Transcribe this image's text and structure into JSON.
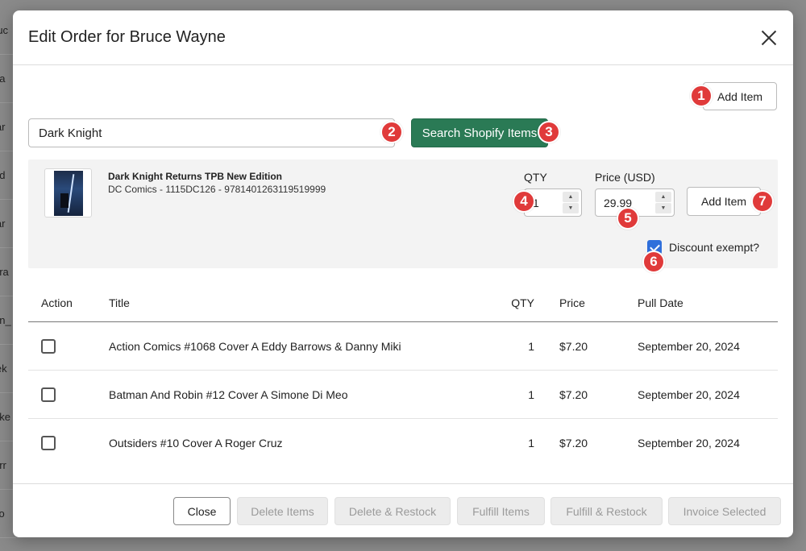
{
  "background": {
    "row_fragments": [
      "ruc",
      "ria",
      "lar",
      "ed",
      "iar",
      "ara",
      "en_",
      "iek",
      "uke",
      "arr",
      "co"
    ]
  },
  "modal": {
    "title": "Edit Order for Bruce Wayne",
    "close_icon": "close-icon",
    "add_item_top_label": "Add Item",
    "search": {
      "value": "Dark Knight",
      "button_label": "Search Shopify Items"
    },
    "result": {
      "title": "Dark Knight Returns TPB New Edition",
      "subtitle": "DC Comics - 1115DC126 - 9781401263119519999",
      "qty_label": "QTY",
      "qty_value": "1",
      "price_label": "Price (USD)",
      "price_value": "29.99",
      "add_button_label": "Add Item",
      "discount_label": "Discount exempt?",
      "discount_checked": true
    },
    "table": {
      "headers": {
        "action": "Action",
        "title": "Title",
        "qty": "QTY",
        "price": "Price",
        "pull_date": "Pull Date"
      },
      "rows": [
        {
          "title": "Action Comics #1068 Cover A Eddy Barrows & Danny Miki",
          "qty": "1",
          "price": "$7.20",
          "pull_date": "September 20, 2024"
        },
        {
          "title": "Batman And Robin #12 Cover A Simone Di Meo",
          "qty": "1",
          "price": "$7.20",
          "pull_date": "September 20, 2024"
        },
        {
          "title": "Outsiders #10 Cover A Roger Cruz",
          "qty": "1",
          "price": "$7.20",
          "pull_date": "September 20, 2024"
        }
      ]
    },
    "footer": {
      "close": "Close",
      "delete_items": "Delete Items",
      "delete_restock": "Delete & Restock",
      "fulfill_items": "Fulfill Items",
      "fulfill_restock": "Fulfill & Restock",
      "invoice_selected": "Invoice Selected"
    }
  },
  "annotations": [
    "1",
    "2",
    "3",
    "4",
    "5",
    "6",
    "7"
  ],
  "colors": {
    "accent_green": "#2a7a55",
    "badge_red": "#e03a3a",
    "check_blue": "#2f6fdb"
  }
}
